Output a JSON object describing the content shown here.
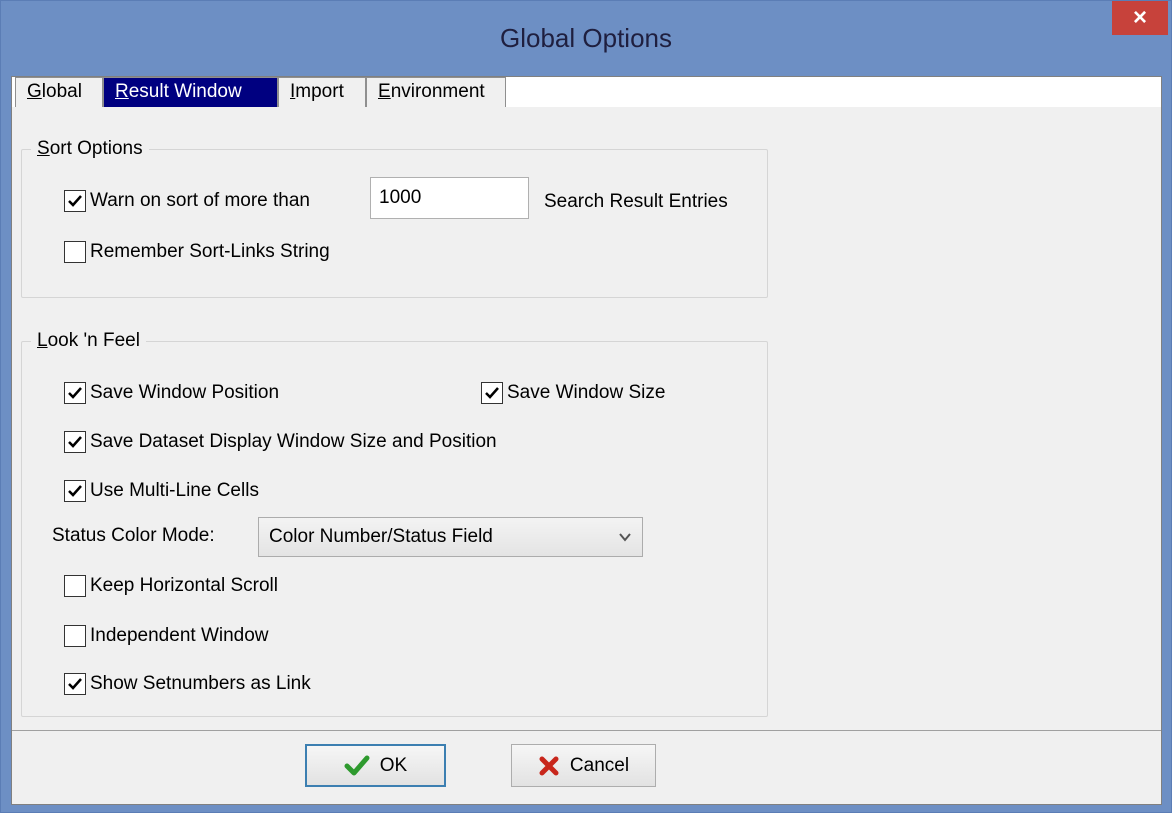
{
  "window": {
    "title": "Global Options",
    "close_glyph": "×"
  },
  "tabs": [
    {
      "label_u": "G",
      "label_rest": "lobal",
      "active": false
    },
    {
      "label_u": "R",
      "label_rest": "esult Window",
      "active": true
    },
    {
      "label_u": "I",
      "label_rest": "mport",
      "active": false
    },
    {
      "label_u": "E",
      "label_rest": "nvironment",
      "active": false
    }
  ],
  "sort_options": {
    "title_u": "S",
    "title_rest": "ort Options",
    "warn_label": "Warn on sort of more than",
    "warn_checked": true,
    "warn_value": "1000",
    "entries_label": "Search Result Entries",
    "remember_label": "Remember Sort-Links String",
    "remember_checked": false
  },
  "look_feel": {
    "title_u": "L",
    "title_rest": "ook 'n Feel",
    "save_pos_label": "Save Window Position",
    "save_pos_checked": true,
    "save_size_label": "Save Window Size",
    "save_size_checked": true,
    "save_dataset_label": "Save Dataset Display Window Size and Position",
    "save_dataset_checked": true,
    "multiline_label": "Use Multi-Line Cells",
    "multiline_checked": true,
    "status_color_label": "Status Color Mode:",
    "status_color_value": "Color Number/Status Field",
    "keep_scroll_label": "Keep Horizontal Scroll",
    "keep_scroll_checked": false,
    "independent_label": "Independent Window",
    "independent_checked": false,
    "setnumbers_label": "Show Setnumbers as Link",
    "setnumbers_checked": true
  },
  "buttons": {
    "ok_label": "OK",
    "cancel_label": "Cancel"
  },
  "colors": {
    "title_bar": "#6d8fc4",
    "close": "#c7423b",
    "active_tab": "#000080",
    "ok_check": "#2e9a2e",
    "cancel_x": "#c8261b"
  }
}
